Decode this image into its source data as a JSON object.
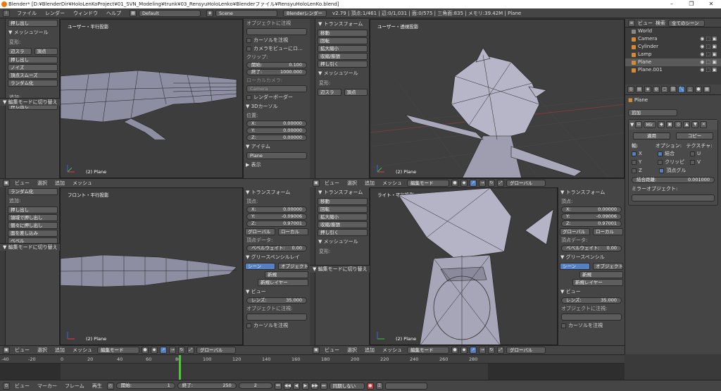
{
  "window": {
    "title": "Blender* [D:¥BlenderDir¥HoloLenKoProject¥01_SVN_Modeling¥trunk¥03_RensyuHoloLenko¥Blenderファイル¥RensyuHoloLenKo.blend]",
    "controls": [
      "–",
      "❐",
      "✕"
    ]
  },
  "menubar": {
    "items": [
      "ファイル",
      "レンダー",
      "ウィンドウ",
      "ヘルプ"
    ],
    "screen_layout": "Default",
    "scene": "Scene",
    "render_engine": "Blenderレンダー",
    "stats": "v2.79 | 頂点:1/461 | 辺:0/1,031 | 面:0/575 | 三角面:835 | メモリ:39.42M | Plane"
  },
  "shelf_tl": {
    "top_button": "押し出し",
    "header": "メッシュツール",
    "deform_label": "変形:",
    "buttons": [
      "辺スラ",
      "頂点",
      "押し出し",
      "ノイズ",
      "頂点スムーズ",
      "ランダム化"
    ],
    "add_label": "追加:",
    "add_dropdown": "押し出し",
    "last_op": "編集モードに切り替え"
  },
  "shelf_bl": {
    "buttons": [
      "ランダム化"
    ],
    "add_label": "追加:",
    "add_buttons": [
      "押し出し",
      "領域で押し出し",
      "個々に押し出し",
      "面を差し込み",
      "ベベル"
    ],
    "last_op": "編集モードに切り替え"
  },
  "shelf_tr": {
    "header_transform": "トランスフォーム",
    "transform_buttons": [
      "移動",
      "回転",
      "拡大縮小",
      "収縮/膨張",
      "押し引く"
    ],
    "header_mesh": "メッシュツール",
    "deform_label": "変形:",
    "deform_buttons": [
      "辺スラ",
      "頂点"
    ]
  },
  "shelf_br": {
    "header_transform": "トランスフォーム",
    "transform_buttons": [
      "移動",
      "回転",
      "拡大縮小",
      "収縮/膨張",
      "押し引く"
    ],
    "header_mesh": "メッシュツール",
    "deform_label": "変形:",
    "last_op": "編集モードに切り替え"
  },
  "viewports": {
    "tl": {
      "title": "ユーザー・平行投影",
      "object": "(2) Plane"
    },
    "tr": {
      "title": "ユーザー・透視投影",
      "object": "(2) Plane"
    },
    "bl": {
      "title": "フロント・平行投影",
      "object": "(2) Plane"
    },
    "br": {
      "title": "ライト・平行投影",
      "object": "(2) Plane"
    }
  },
  "npanel_tl": {
    "lock_header": "オブジェクトに注視",
    "cursor_lock": "カーソルを注視",
    "camera_view": "カメラをビューにロ...",
    "clip_label": "クリップ:",
    "clip_start": {
      "label": "開始:",
      "value": "0.100"
    },
    "clip_end": {
      "label": "終了:",
      "value": "1000.000"
    },
    "local_camera": "ローカルカメラ:",
    "camera_field": "Camera",
    "render_border": "レンダーボーダー",
    "cursor_header": "3Dカーソル",
    "location_label": "位置:",
    "cx": {
      "label": "X:",
      "value": "0.00000"
    },
    "cy": {
      "label": "Y:",
      "value": "0.00000"
    },
    "cz": {
      "label": "Z:",
      "value": "0.00000"
    },
    "item_header": "アイテム",
    "item_name": "Plane",
    "display_header": "表示"
  },
  "npanel_bl": {
    "transform_header": "トランスフォーム",
    "vertex_label": "頂点:",
    "vx": {
      "label": "X:",
      "value": "0.00000"
    },
    "vy": {
      "label": "Y:",
      "value": "-0.09006"
    },
    "vz": {
      "label": "Z:",
      "value": "0.97001"
    },
    "global": "グローバル",
    "local": "ローカル",
    "vdata_label": "頂点データ:",
    "bevel": {
      "label": "ベベルウェイト:",
      "value": "0.00"
    },
    "gp_header": "グリースペンシルレイ",
    "scene_btn": "シーン",
    "object_btn": "オブジェクト",
    "new_btn": "新規",
    "new_layer": "新規レイヤー",
    "view_header": "ビュー",
    "lens": {
      "label": "レンズ:",
      "value": "35.000"
    },
    "lock_obj": "オブジェクトに注視:",
    "cursor_lock": "カーソルを注視"
  },
  "npanel_br": {
    "transform_header": "トランスフォーム",
    "vertex_label": "頂点:",
    "vx": {
      "label": "X:",
      "value": "0.00000"
    },
    "vy": {
      "label": "Y:",
      "value": "-0.09006"
    },
    "vz": {
      "label": "Z:",
      "value": "0.97001"
    },
    "global": "グローバル",
    "local": "ローカル",
    "vdata_label": "頂点データ:",
    "bevel": {
      "label": "ベベルウェイト:",
      "value": "0.00"
    },
    "gp_header": "グリースペンシル",
    "scene_btn": "シーン",
    "object_btn": "オブジェクト",
    "new_btn": "新規",
    "new_layer": "新規レイヤー",
    "view_header": "ビュー",
    "lens": {
      "label": "レンズ:",
      "value": "35.000"
    },
    "lock_obj": "オブジェクトに注視:",
    "cursor_lock": "カーソルを注視"
  },
  "vheader": {
    "menus": [
      "ビュー",
      "選択",
      "追加",
      "メッシュ"
    ],
    "mode": "編集モード",
    "orientation": "グローバル"
  },
  "outliner": {
    "menus": [
      "ビュー",
      "検索"
    ],
    "filter": "全てのシーン",
    "items": [
      "World",
      "Camera",
      "Cylinder",
      "Lamp",
      "Plane",
      "Plane.001"
    ]
  },
  "properties": {
    "object": "Plane",
    "add_modifier": "追加",
    "modifier_name": "Mir",
    "apply": "適用",
    "copy": "コピー",
    "axis_label": "軸:",
    "options_label": "オプション:",
    "texture_label": "テクスチャ:",
    "x": "X",
    "y": "Y",
    "z": "Z",
    "merge": "結合",
    "clipping": "クリッピ",
    "vgroup": "頂点グル",
    "u": "U",
    "v": "V",
    "merge_dist": {
      "label": "結合距離:",
      "value": "0.001000"
    },
    "mirror_obj": "ミラーオブジェクト:"
  },
  "timeline": {
    "ticks": [
      "-40",
      "-20",
      "0",
      "20",
      "40",
      "60",
      "80",
      "100",
      "120",
      "140",
      "160",
      "180",
      "200",
      "220",
      "240",
      "260",
      "280"
    ],
    "menus": [
      "ビュー",
      "マーカー",
      "フレーム",
      "再生"
    ],
    "start": {
      "label": "開始:",
      "value": "1"
    },
    "end": {
      "label": "終了:",
      "value": "250"
    },
    "current": "2",
    "sync": "同期しない"
  },
  "colors": {
    "accent": "#5680c2",
    "orange": "#e87d0d",
    "timeline_cursor": "#4ec832"
  }
}
